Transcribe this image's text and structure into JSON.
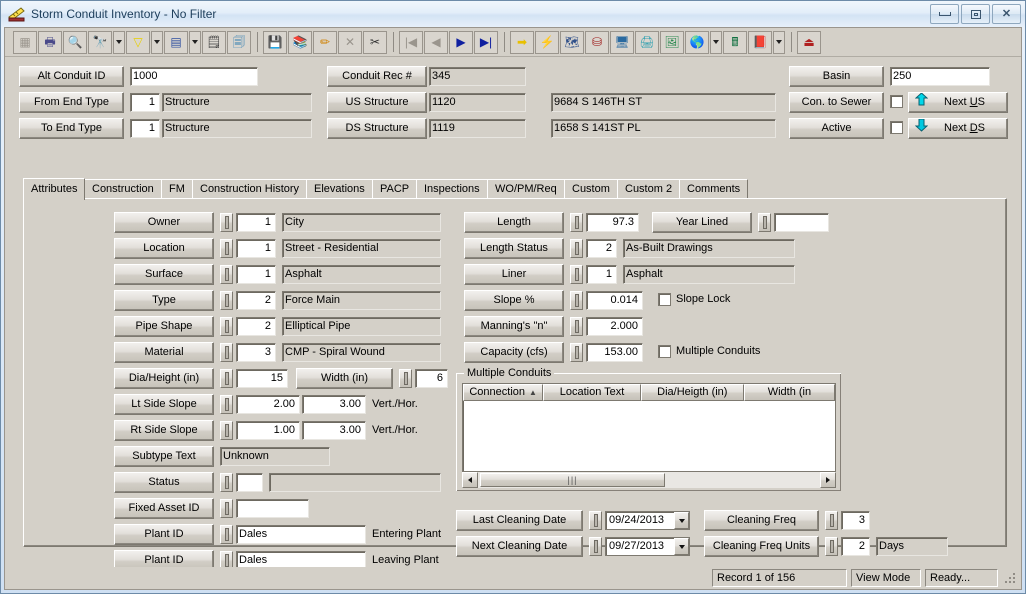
{
  "window": {
    "title": "Storm Conduit Inventory - No Filter",
    "icon": "pencil-ruler-icon",
    "minimize": "minimize",
    "maximize": "restore",
    "close": "close"
  },
  "toolbar": {
    "buttons": [
      {
        "name": "select-grid-icon",
        "glyph": "▦",
        "framed": true,
        "disabled": true
      },
      {
        "name": "print-icon",
        "glyph": "🖶",
        "framed": true
      },
      {
        "name": "print-preview-icon",
        "glyph": "🔍",
        "framed": true
      },
      {
        "name": "find-icon",
        "glyph": "🔭",
        "framed": true
      },
      {
        "name": "find-dropdown-arrow",
        "glyph": "▼",
        "isArrow": true
      },
      {
        "name": "filter-icon",
        "glyph": "▽",
        "framed": true
      },
      {
        "name": "filter-dropdown-arrow",
        "glyph": "▼",
        "isArrow": true
      },
      {
        "name": "report-icon",
        "glyph": "▤",
        "framed": true
      },
      {
        "name": "report-dropdown-arrow",
        "glyph": "▼",
        "isArrow": true
      },
      {
        "name": "properties-icon",
        "glyph": "🗒",
        "framed": true
      },
      {
        "name": "copy-record-icon",
        "glyph": "🗐",
        "framed": true
      },
      {
        "name": "separator-1",
        "isSep": true
      },
      {
        "name": "save-icon",
        "glyph": "💾",
        "framed": true,
        "disabled": true
      },
      {
        "name": "new-record-icon",
        "glyph": "📚",
        "framed": true
      },
      {
        "name": "edit-record-icon",
        "glyph": "✏",
        "framed": true
      },
      {
        "name": "delete-record-icon",
        "glyph": "✕",
        "framed": true,
        "disabled": true
      },
      {
        "name": "cut-icon",
        "glyph": "✂",
        "framed": true
      },
      {
        "name": "separator-2",
        "isSep": true
      },
      {
        "name": "first-record-icon",
        "glyph": "|◀",
        "framed": true,
        "disabled": true
      },
      {
        "name": "previous-record-icon",
        "glyph": "◀",
        "framed": true,
        "disabled": true
      },
      {
        "name": "next-record-icon",
        "glyph": "▶",
        "framed": true
      },
      {
        "name": "last-record-icon",
        "glyph": "▶|",
        "framed": true
      },
      {
        "name": "separator-3",
        "isSep": true
      },
      {
        "name": "goto-icon",
        "glyph": "➡",
        "framed": true
      },
      {
        "name": "lightning-icon",
        "glyph": "⚡",
        "framed": true
      },
      {
        "name": "workflow-icon",
        "glyph": "🗺",
        "framed": true
      },
      {
        "name": "tree-view-icon",
        "glyph": "⛁",
        "framed": true
      },
      {
        "name": "map-view-icon",
        "glyph": "🖥",
        "framed": true
      },
      {
        "name": "fax-icon",
        "glyph": "🖨",
        "framed": true
      },
      {
        "name": "gis-icon",
        "glyph": "🖼",
        "framed": true
      },
      {
        "name": "globe-icon",
        "glyph": "🌎",
        "framed": true
      },
      {
        "name": "globe-dropdown-arrow",
        "glyph": "▼",
        "isArrow": true
      },
      {
        "name": "calculator-icon",
        "glyph": "🖩",
        "framed": true
      },
      {
        "name": "help-book-icon",
        "glyph": "📕",
        "framed": true
      },
      {
        "name": "help-dropdown-arrow",
        "glyph": "▼",
        "isArrow": true
      },
      {
        "name": "separator-4",
        "isSep": true
      },
      {
        "name": "exit-icon",
        "glyph": "⏏",
        "framed": true
      }
    ]
  },
  "header": {
    "alt_conduit_id_label": "Alt Conduit ID",
    "alt_conduit_id_value": "1000",
    "from_end_type_label": "From End Type",
    "from_end_type_code": "1",
    "from_end_type_text": "Structure",
    "to_end_type_label": "To End Type",
    "to_end_type_code": "1",
    "to_end_type_text": "Structure",
    "conduit_rec_label": "Conduit Rec #",
    "conduit_rec_value": "345",
    "us_structure_label": "US Structure",
    "us_structure_value": "1120",
    "us_structure_address": "9684  S  146TH ST",
    "ds_structure_label": "DS Structure",
    "ds_structure_value": "1119",
    "ds_structure_address": "1658  S  141ST PL",
    "basin_label": "Basin",
    "basin_value": "250",
    "con_to_sewer_label": "Con. to Sewer",
    "active_label": "Active",
    "next_us_label": "Next US",
    "next_ds_label": "Next DS",
    "up_arrow_color": "#00d8e8",
    "down_arrow_color": "#00c8e0"
  },
  "tabs": [
    {
      "label": "Attributes",
      "active": true
    },
    {
      "label": "Construction",
      "active": false
    },
    {
      "label": "FM",
      "active": false
    },
    {
      "label": "Construction History",
      "active": false
    },
    {
      "label": "Elevations",
      "active": false
    },
    {
      "label": "PACP",
      "active": false
    },
    {
      "label": "Inspections",
      "active": false
    },
    {
      "label": "WO/PM/Req",
      "active": false
    },
    {
      "label": "Custom",
      "active": false
    },
    {
      "label": "Custom 2",
      "active": false
    },
    {
      "label": "Comments",
      "active": false
    }
  ],
  "attributes": {
    "left_rows": [
      {
        "label": "Owner",
        "code": "1",
        "text": "City"
      },
      {
        "label": "Location",
        "code": "1",
        "text": "Street - Residential"
      },
      {
        "label": "Surface",
        "code": "1",
        "text": "Asphalt"
      },
      {
        "label": "Type",
        "code": "2",
        "text": "Force Main"
      },
      {
        "label": "Pipe Shape",
        "code": "2",
        "text": "Elliptical Pipe"
      },
      {
        "label": "Material",
        "code": "3",
        "text": "CMP - Spiral Wound"
      }
    ],
    "dia_height_label": "Dia/Height (in)",
    "dia_height_value": "15",
    "width_label": "Width (in)",
    "width_value": "6",
    "lt_side_slope_label": "Lt Side Slope",
    "lt_side_slope_v": "2.00",
    "lt_side_slope_h": "3.00",
    "lt_side_slope_unit": "Vert./Hor.",
    "rt_side_slope_label": "Rt Side Slope",
    "rt_side_slope_v": "1.00",
    "rt_side_slope_h": "3.00",
    "rt_side_slope_unit": "Vert./Hor.",
    "subtype_text_label": "Subtype Text",
    "subtype_text_value": "Unknown",
    "status_label": "Status",
    "status_code": "",
    "status_text": "",
    "fixed_asset_label": "Fixed Asset ID",
    "fixed_asset_value": "",
    "plant_id_entering_label": "Plant ID",
    "plant_id_entering_value": "Dales",
    "plant_id_entering_note": "Entering Plant",
    "plant_id_leaving_label": "Plant ID",
    "plant_id_leaving_value": "Dales",
    "plant_id_leaving_note": "Leaving Plant"
  },
  "hydraulics": {
    "length_label": "Length",
    "length_value": "97.3",
    "year_lined_label": "Year Lined",
    "year_lined_value": "",
    "length_status_label": "Length Status",
    "length_status_code": "2",
    "length_status_text": "As-Built Drawings",
    "liner_label": "Liner",
    "liner_code": "1",
    "liner_text": "Asphalt",
    "slope_label": "Slope %",
    "slope_value": "0.014",
    "slope_lock_label": "Slope Lock",
    "mannings_label": "Manning's \"n\"",
    "mannings_value": "2.000",
    "capacity_label": "Capacity (cfs)",
    "capacity_value": "153.00",
    "multiple_conduits_label": "Multiple Conduits"
  },
  "multiple_conduits": {
    "group_title": "Multiple Conduits",
    "columns": [
      "Connection",
      "Location Text",
      "Dia/Heigth (in)",
      "Width (in"
    ],
    "sort_indicator": "▲",
    "rows": []
  },
  "cleaning": {
    "last_cleaning_date_label": "Last Cleaning Date",
    "last_cleaning_date_value": "09/24/2013",
    "next_cleaning_date_label": "Next Cleaning Date",
    "next_cleaning_date_value": "09/27/2013",
    "cleaning_freq_label": "Cleaning Freq",
    "cleaning_freq_value": "3",
    "cleaning_freq_units_label": "Cleaning Freq Units",
    "cleaning_freq_units_code": "2",
    "cleaning_freq_units_text": "Days"
  },
  "statusbar": {
    "record": "Record 1 of 156",
    "mode": "View Mode",
    "state": "Ready..."
  }
}
